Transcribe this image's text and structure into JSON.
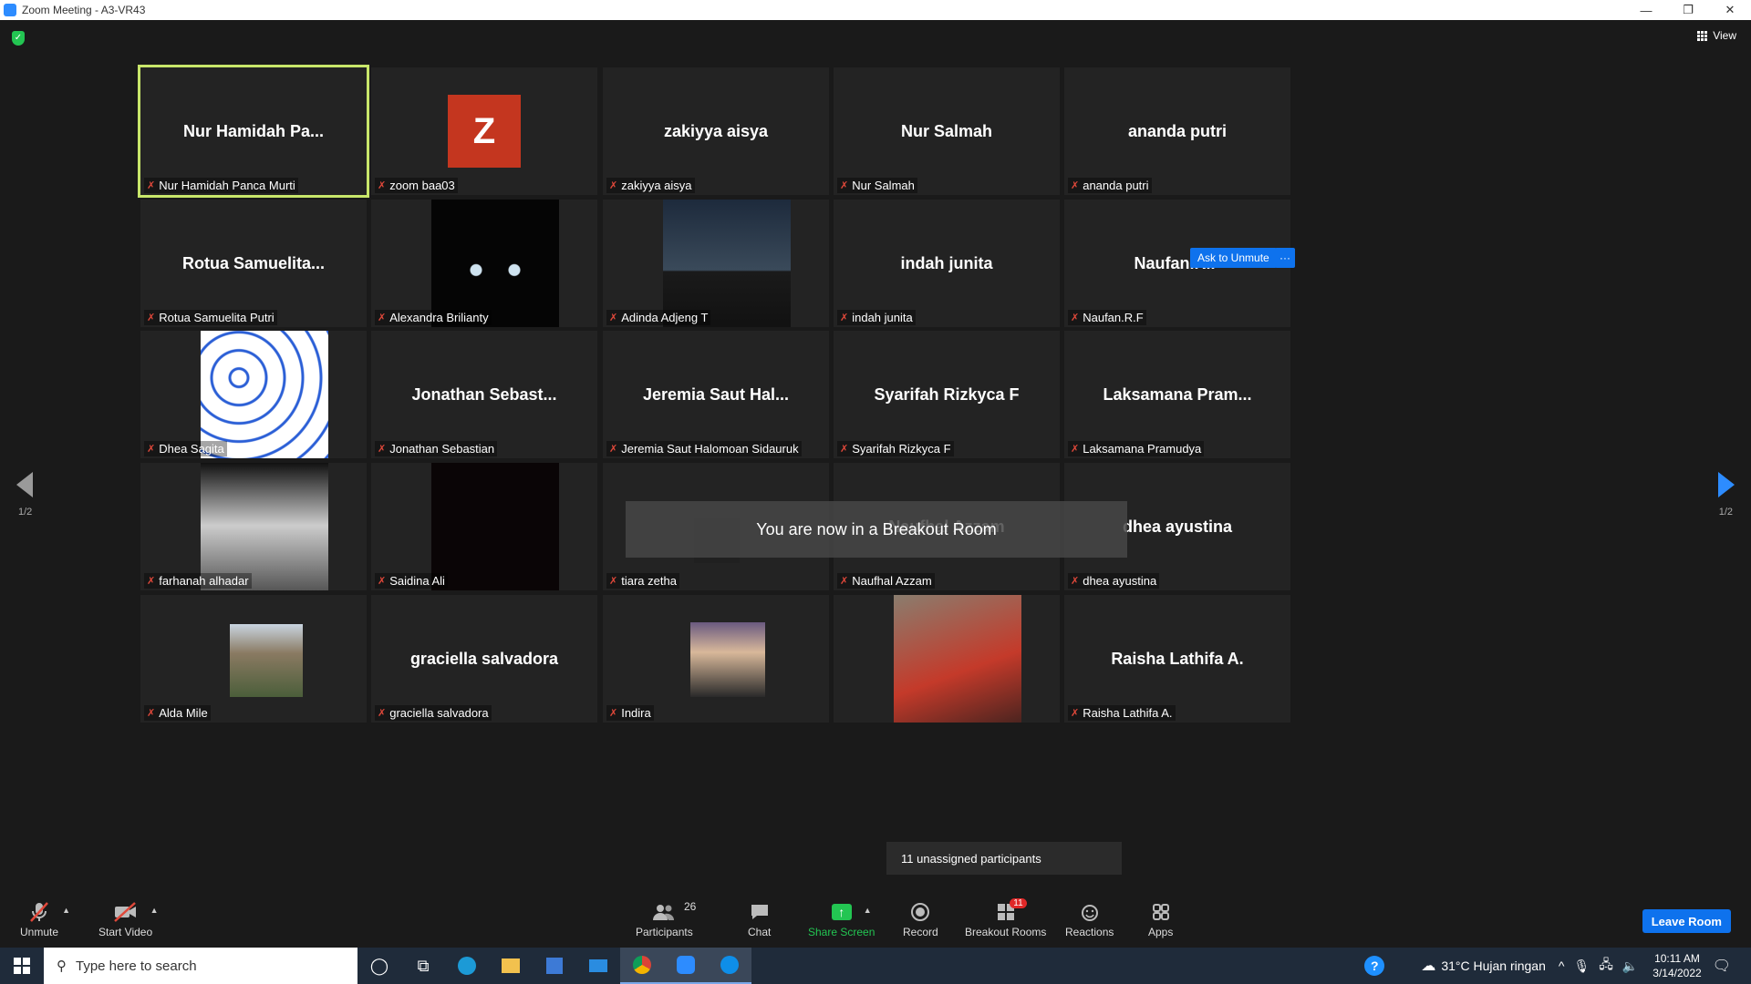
{
  "window": {
    "title": "Zoom Meeting - A3-VR43",
    "minimize": "—",
    "restore": "❐",
    "close": "✕"
  },
  "top": {
    "view_label": "View"
  },
  "tiles": [
    {
      "big": "Nur  Hamidah  Pa...",
      "label": "Nur Hamidah Panca Murti"
    },
    {
      "big": "Z",
      "label": "zoom baa03"
    },
    {
      "big": "zakiyya  aisya",
      "label": "zakiyya aisya"
    },
    {
      "big": "Nur  Salmah",
      "label": "Nur Salmah"
    },
    {
      "big": "ananda  putri",
      "label": "ananda putri"
    },
    {
      "big": "Rotua  Samuelita...",
      "label": "Rotua Samuelita Putri"
    },
    {
      "big": "",
      "label": "Alexandra Brilianty"
    },
    {
      "big": "",
      "label": "Adinda Adjeng T"
    },
    {
      "big": "indah  junita",
      "label": "indah junita"
    },
    {
      "big": "Naufan.R.F",
      "label": "Naufan.R.F"
    },
    {
      "big": "",
      "label": "Dhea Sagita"
    },
    {
      "big": "Jonathan  Sebast...",
      "label": "Jonathan Sebastian"
    },
    {
      "big": "Jeremia  Saut  Hal...",
      "label": "Jeremia Saut Halomoan Sidauruk"
    },
    {
      "big": "Syarifah  Rizkyca  F",
      "label": "Syarifah Rizkyca F"
    },
    {
      "big": "Laksamana  Pram...",
      "label": "Laksamana Pramudya"
    },
    {
      "big": "",
      "label": "farhanah alhadar"
    },
    {
      "big": "",
      "label": "Saidina Ali"
    },
    {
      "big": "",
      "label": "tiara zetha"
    },
    {
      "big": "Naufhal  Azzam",
      "label": "Naufhal Azzam"
    },
    {
      "big": "dhea  ayustina",
      "label": "dhea ayustina"
    },
    {
      "big": "",
      "label": "Alda Mile"
    },
    {
      "big": "graciella  salvadora",
      "label": "graciella salvadora"
    },
    {
      "big": "",
      "label": "Indira"
    },
    {
      "big": "",
      "label": ""
    },
    {
      "big": "Raisha  Lathifa  A.",
      "label": "Raisha Lathifa A."
    }
  ],
  "overlay": {
    "ask_unmute": "Ask to Unmute",
    "more": "···",
    "breakout_toast": "You are now in a Breakout Room",
    "unassigned": "11 unassigned participants",
    "page_left": "1/2",
    "page_right": "1/2"
  },
  "toolbar": {
    "unmute": "Unmute",
    "start_video": "Start Video",
    "participants": "Participants",
    "participants_count": "26",
    "chat": "Chat",
    "share_screen": "Share Screen",
    "record": "Record",
    "breakout_rooms": "Breakout Rooms",
    "breakout_badge": "11",
    "reactions": "Reactions",
    "apps": "Apps",
    "leave": "Leave Room"
  },
  "taskbar": {
    "search_placeholder": "Type here to search",
    "weather": "31°C  Hujan ringan",
    "time": "10:11 AM",
    "date": "3/14/2022"
  },
  "colors": {
    "accent": "#0e72ed",
    "active_speaker": "#c8e66a",
    "share_green": "#23c552",
    "badge_red": "#e02828"
  }
}
